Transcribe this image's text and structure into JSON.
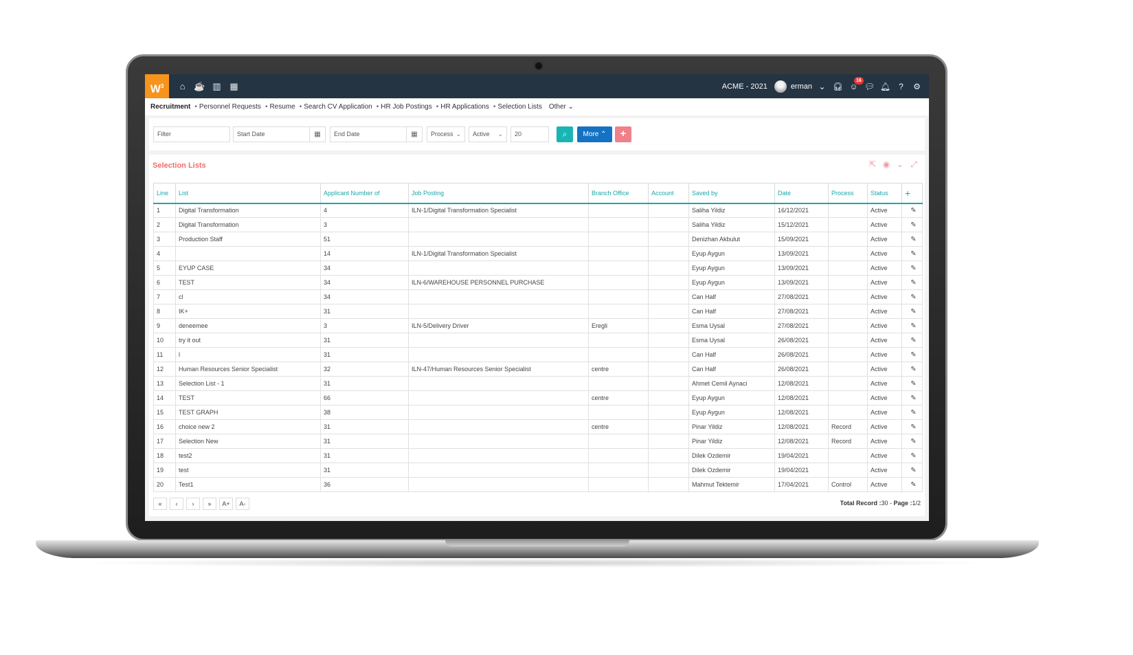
{
  "topbar": {
    "logo": "W",
    "logo_sup": "3",
    "nav_icons": [
      "home-icon",
      "coffee-icon",
      "chart-icon",
      "calendar-icon"
    ],
    "company": "ACME - 2021",
    "user": "erman",
    "notification_count": "16"
  },
  "subnav": {
    "items": [
      "Recruitment",
      "Personnel Requests",
      "Resume",
      "Search CV Application",
      "HR Job Postings",
      "HR Applications",
      "Selection Lists",
      "Other"
    ]
  },
  "filters": {
    "filter_placeholder": "Filter",
    "start_date_placeholder": "Start Date",
    "end_date_placeholder": "End Date",
    "process_value": "Process",
    "status_value": "Active",
    "page_size": "20",
    "more_label": "More"
  },
  "panel": {
    "title": "Selection Lists"
  },
  "table": {
    "columns": [
      "Line",
      "List",
      "Applicant Number of",
      "Job Posting",
      "Branch Office",
      "Account",
      "Saved by",
      "Date",
      "Process",
      "Status"
    ],
    "rows": [
      {
        "line": "1",
        "list": "Digital Transformation",
        "applicants": "4",
        "job": "ILN-1/Digital Transformation Specialist",
        "branch": "",
        "account": "",
        "saved_by": "Saliha Yildiz",
        "date": "16/12/2021",
        "process": "",
        "status": "Active"
      },
      {
        "line": "2",
        "list": "Digital Transformation",
        "applicants": "3",
        "job": "",
        "branch": "",
        "account": "",
        "saved_by": "Saliha Yildiz",
        "date": "15/12/2021",
        "process": "",
        "status": "Active"
      },
      {
        "line": "3",
        "list": "Production Staff",
        "applicants": "51",
        "job": "",
        "branch": "",
        "account": "",
        "saved_by": "Denizhan Akbulut",
        "date": "15/09/2021",
        "process": "",
        "status": "Active"
      },
      {
        "line": "4",
        "list": "",
        "applicants": "14",
        "job": "ILN-1/Digital Transformation Specialist",
        "branch": "",
        "account": "",
        "saved_by": "Eyup Aygun",
        "date": "13/09/2021",
        "process": "",
        "status": "Active"
      },
      {
        "line": "5",
        "list": "EYUP CASE",
        "applicants": "34",
        "job": "",
        "branch": "",
        "account": "",
        "saved_by": "Eyup Aygun",
        "date": "13/09/2021",
        "process": "",
        "status": "Active"
      },
      {
        "line": "6",
        "list": "TEST",
        "applicants": "34",
        "job": "ILN-6/WAREHOUSE PERSONNEL PURCHASE",
        "branch": "",
        "account": "",
        "saved_by": "Eyup Aygun",
        "date": "13/09/2021",
        "process": "",
        "status": "Active"
      },
      {
        "line": "7",
        "list": "cl",
        "applicants": "34",
        "job": "",
        "branch": "",
        "account": "",
        "saved_by": "Can Half",
        "date": "27/08/2021",
        "process": "",
        "status": "Active"
      },
      {
        "line": "8",
        "list": "IK+",
        "applicants": "31",
        "job": "",
        "branch": "",
        "account": "",
        "saved_by": "Can Half",
        "date": "27/08/2021",
        "process": "",
        "status": "Active"
      },
      {
        "line": "9",
        "list": "deneemee",
        "applicants": "3",
        "job": "ILN-5/Delivery Driver",
        "branch": "Eregli",
        "account": "",
        "saved_by": "Esma Uysal",
        "date": "27/08/2021",
        "process": "",
        "status": "Active"
      },
      {
        "line": "10",
        "list": "try it out",
        "applicants": "31",
        "job": "",
        "branch": "",
        "account": "",
        "saved_by": "Esma Uysal",
        "date": "26/08/2021",
        "process": "",
        "status": "Active"
      },
      {
        "line": "11",
        "list": "l",
        "applicants": "31",
        "job": "",
        "branch": "",
        "account": "",
        "saved_by": "Can Half",
        "date": "26/08/2021",
        "process": "",
        "status": "Active"
      },
      {
        "line": "12",
        "list": "Human Resources Senior Specialist",
        "applicants": "32",
        "job": "ILN-47/Human Resources Senior Specialist",
        "branch": "centre",
        "account": "",
        "saved_by": "Can Half",
        "date": "26/08/2021",
        "process": "",
        "status": "Active"
      },
      {
        "line": "13",
        "list": "Selection List - 1",
        "applicants": "31",
        "job": "",
        "branch": "",
        "account": "",
        "saved_by": "Ahmet Cemil Aynaci",
        "date": "12/08/2021",
        "process": "",
        "status": "Active"
      },
      {
        "line": "14",
        "list": "TEST",
        "applicants": "66",
        "job": "",
        "branch": "centre",
        "account": "",
        "saved_by": "Eyup Aygun",
        "date": "12/08/2021",
        "process": "",
        "status": "Active"
      },
      {
        "line": "15",
        "list": "TEST GRAPH",
        "applicants": "38",
        "job": "",
        "branch": "",
        "account": "",
        "saved_by": "Eyup Aygun",
        "date": "12/08/2021",
        "process": "",
        "status": "Active"
      },
      {
        "line": "16",
        "list": "choice new 2",
        "applicants": "31",
        "job": "",
        "branch": "centre",
        "account": "",
        "saved_by": "Pinar Yildiz",
        "date": "12/08/2021",
        "process": "Record",
        "status": "Active"
      },
      {
        "line": "17",
        "list": "Selection New",
        "applicants": "31",
        "job": "",
        "branch": "",
        "account": "",
        "saved_by": "Pinar Yildiz",
        "date": "12/08/2021",
        "process": "Record",
        "status": "Active"
      },
      {
        "line": "18",
        "list": "test2",
        "applicants": "31",
        "job": "",
        "branch": "",
        "account": "",
        "saved_by": "Dilek Ozdemir",
        "date": "19/04/2021",
        "process": "",
        "status": "Active"
      },
      {
        "line": "19",
        "list": "test",
        "applicants": "31",
        "job": "",
        "branch": "",
        "account": "",
        "saved_by": "Dilek Ozdemir",
        "date": "19/04/2021",
        "process": "",
        "status": "Active"
      },
      {
        "line": "20",
        "list": "Test1",
        "applicants": "36",
        "job": "",
        "branch": "",
        "account": "",
        "saved_by": "Mahmut Tektemir",
        "date": "17/04/2021",
        "process": "Control",
        "status": "Active"
      }
    ]
  },
  "pager": {
    "buttons": [
      "«",
      "‹",
      "›",
      "»",
      "A+",
      "A-"
    ],
    "total_label": "Total Record :",
    "total_value": "30",
    "separator": " - ",
    "page_label": "Page :",
    "page_value": "1/2"
  },
  "colors": {
    "topbar": "#243443",
    "logo": "#f7941d",
    "accent": "#19a8a8",
    "more_button": "#1572c2",
    "add_button": "#f0808a",
    "panel_title": "#ef6d6d",
    "badge": "#e53935"
  }
}
